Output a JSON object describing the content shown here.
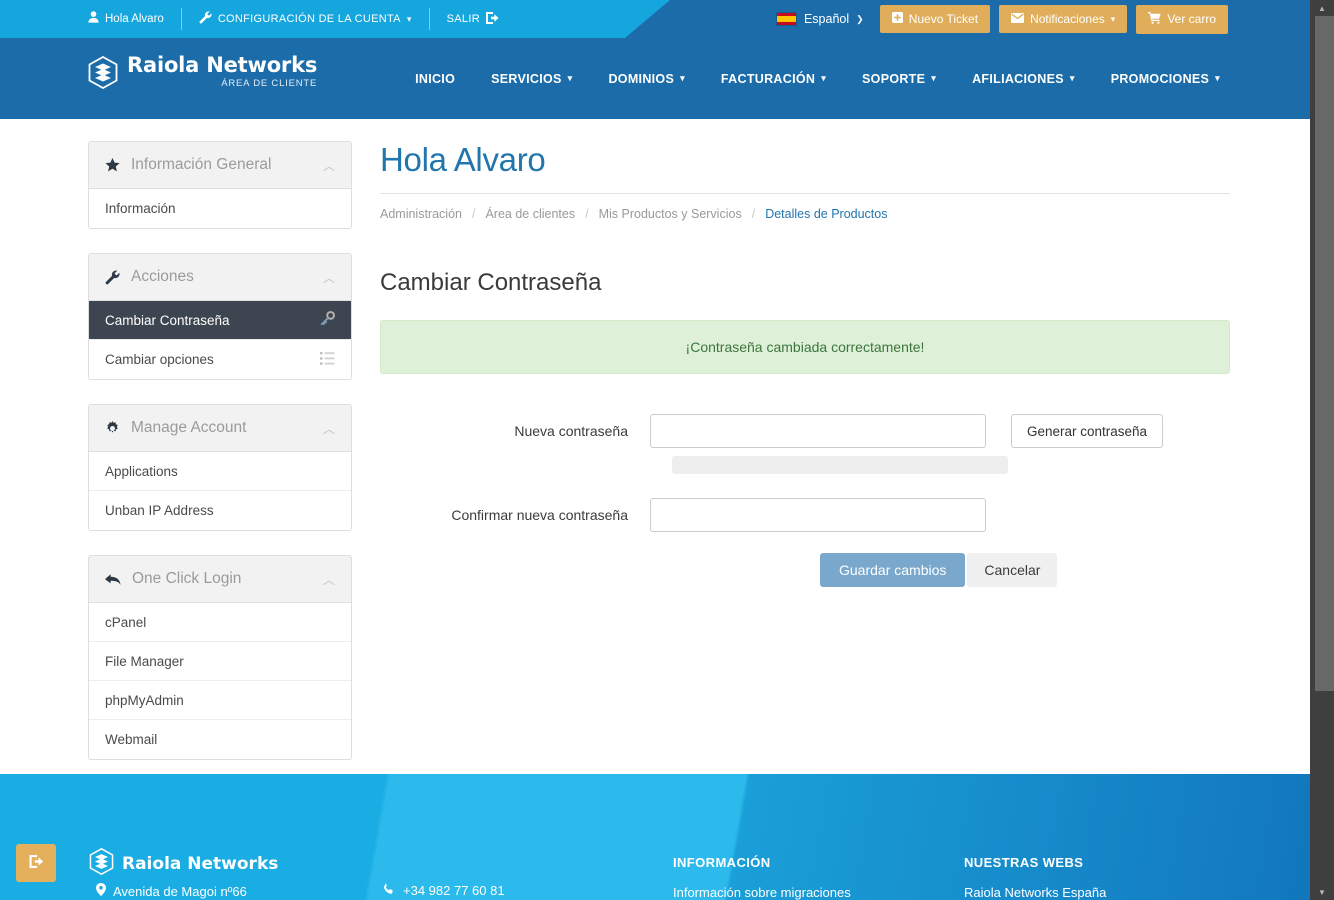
{
  "topbar": {
    "greeting": "Hola Alvaro",
    "greeting_icon": "user-icon",
    "account_config": "CONFIGURACIÓN DE LA CUENTA",
    "account_config_icon": "wrench-icon",
    "logout": "SALIR",
    "logout_icon": "sign-out-icon",
    "language": "Español",
    "language_flag": "spain-flag-icon",
    "buttons": [
      {
        "label": "Nuevo Ticket",
        "icon": "plus-square-icon"
      },
      {
        "label": "Notificaciones",
        "icon": "envelope-icon",
        "caret": true
      },
      {
        "label": "Ver carro",
        "icon": "shopping-cart-icon"
      }
    ],
    "accent_gold": "#e0ad5a",
    "cyan": "#16a6de",
    "blue": "#1b6ca8"
  },
  "brand": {
    "name": "Raiola Networks",
    "subtitle": "ÁREA DE CLIENTE",
    "logo_icon": "hexagon-stack-logo-icon"
  },
  "nav": {
    "items": [
      {
        "label": "INICIO",
        "caret": false
      },
      {
        "label": "SERVICIOS",
        "caret": true
      },
      {
        "label": "DOMINIOS",
        "caret": true
      },
      {
        "label": "FACTURACIÓN",
        "caret": true
      },
      {
        "label": "SOPORTE",
        "caret": true
      },
      {
        "label": "AFILIACIONES",
        "caret": true
      },
      {
        "label": "PROMOCIONES",
        "caret": true
      }
    ]
  },
  "sidebar": {
    "panels": [
      {
        "title": "Información General",
        "icon": "star-icon",
        "collapse_icon": "chevron-up-icon",
        "items": [
          {
            "label": "Información",
            "icon": "",
            "active": false
          }
        ]
      },
      {
        "title": "Acciones",
        "icon": "wrench-icon",
        "collapse_icon": "chevron-up-icon",
        "items": [
          {
            "label": "Cambiar Contraseña",
            "icon": "key-icon",
            "active": true
          },
          {
            "label": "Cambiar opciones",
            "icon": "list-icon",
            "active": false
          }
        ]
      },
      {
        "title": "Manage Account",
        "icon": "gear-icon",
        "collapse_icon": "chevron-up-icon",
        "items": [
          {
            "label": "Applications",
            "icon": "",
            "active": false
          },
          {
            "label": "Unban IP Address",
            "icon": "",
            "active": false
          }
        ]
      },
      {
        "title": "One Click Login",
        "icon": "reply-arrow-icon",
        "collapse_icon": "chevron-up-icon",
        "items": [
          {
            "label": "cPanel",
            "icon": "",
            "active": false
          },
          {
            "label": "File Manager",
            "icon": "",
            "active": false
          },
          {
            "label": "phpMyAdmin",
            "icon": "",
            "active": false
          },
          {
            "label": "Webmail",
            "icon": "",
            "active": false
          }
        ]
      }
    ]
  },
  "main": {
    "page_title": "Hola Alvaro",
    "breadcrumb": [
      {
        "label": "Administración",
        "current": false
      },
      {
        "label": "Área de clientes",
        "current": false
      },
      {
        "label": "Mis Productos y Servicios",
        "current": false
      },
      {
        "label": "Detalles de Productos",
        "current": true
      }
    ],
    "breadcrumb_separator": "/",
    "section_title": "Cambiar Contraseña",
    "alert": {
      "text": "¡Contraseña cambiada correctamente!",
      "type": "success",
      "bg": "#dff0d8",
      "fg": "#3c763d"
    },
    "form": {
      "new_password_label": "Nueva contraseña",
      "new_password_value": "",
      "new_password_placeholder": "",
      "generate_button": "Generar contraseña",
      "strength_meter_value": 0,
      "confirm_password_label": "Confirmar nueva contraseña",
      "confirm_password_value": "",
      "confirm_password_placeholder": "",
      "save_button": "Guardar cambios",
      "cancel_button": "Cancelar",
      "save_button_color": "#7aa8cc"
    }
  },
  "footer": {
    "scroll_top_icon": "sign-out-icon",
    "brand": "Raiola Networks",
    "logo_icon": "hexagon-stack-logo-icon",
    "address": "Avenida de Magoi nº66",
    "address_icon": "map-marker-icon",
    "phone": "+34 982 77 60 81",
    "phone_icon": "phone-icon",
    "columns": [
      {
        "heading": "INFORMACIÓN",
        "links": [
          "Información sobre migraciones"
        ]
      },
      {
        "heading": "NUESTRAS WEBS",
        "links": [
          "Raiola Networks España"
        ]
      }
    ],
    "bg": "#1aade4"
  },
  "scrollbar": {
    "up_icon": "caret-up-icon",
    "down_icon": "caret-down-icon"
  }
}
